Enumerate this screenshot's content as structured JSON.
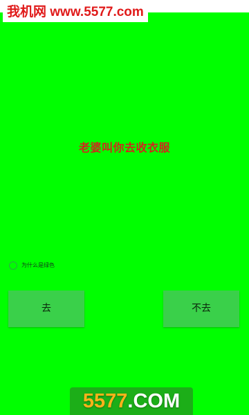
{
  "watermark_top": "我机网 www.5577.com",
  "message": "老婆叫你去收衣服",
  "why_option": {
    "label": "为什么是绿色",
    "checked": false
  },
  "buttons": {
    "go": "去",
    "not_go": "不去"
  },
  "watermark_bottom": {
    "number": "5577",
    "suffix": ".COM"
  },
  "colors": {
    "screen_background": "#00ff00",
    "message_text": "#d0271b",
    "button_background": "#3ad04a",
    "watermark_red": "#e01a1a",
    "watermark_bottom_bg": "#1cae18",
    "watermark_bottom_number": "#ffb21a"
  }
}
